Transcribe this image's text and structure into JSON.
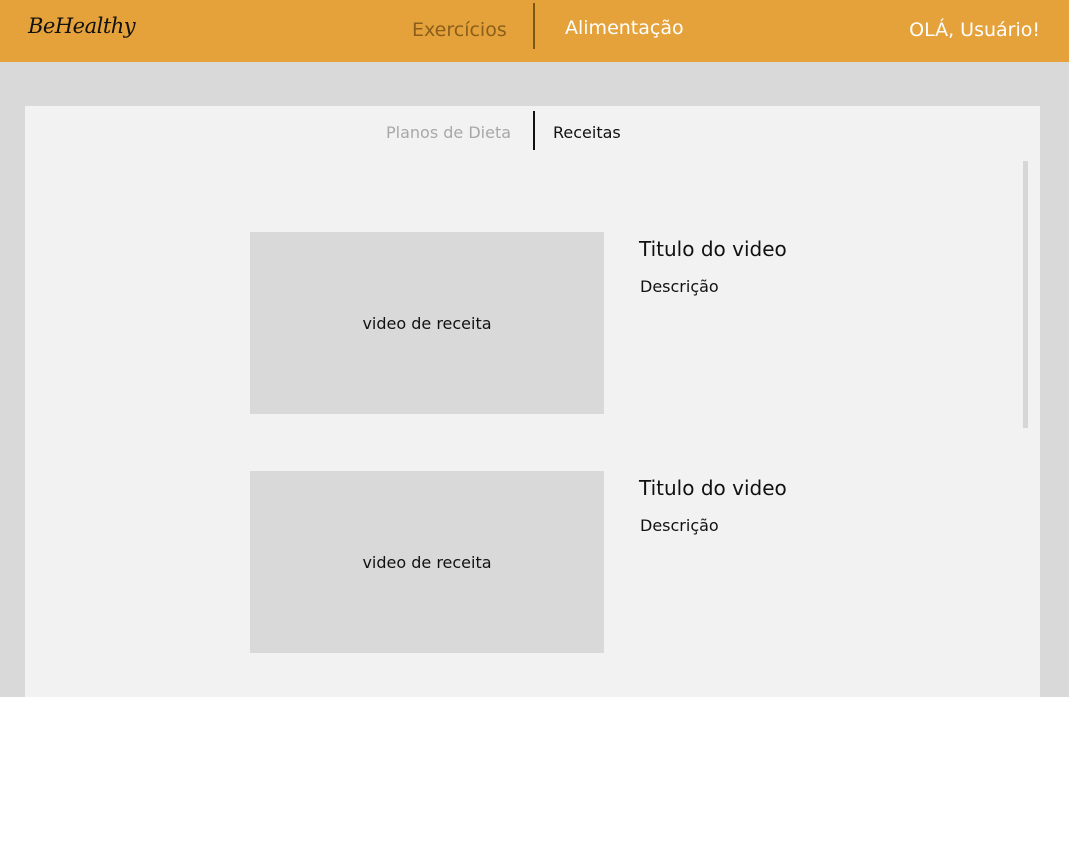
{
  "header": {
    "logo": "BeHealthy",
    "nav": {
      "exercicios": "Exercícios",
      "alimentacao": "Alimentação"
    },
    "greeting": "OLÁ, Usuário!"
  },
  "subtabs": {
    "planos": "Planos de Dieta",
    "receitas": "Receitas"
  },
  "videos": [
    {
      "thumb_label": "video de receita",
      "title": "Titulo do video",
      "description": "Descrição"
    },
    {
      "thumb_label": "video de receita",
      "title": "Titulo do video",
      "description": "Descrição"
    }
  ],
  "colors": {
    "header_bg": "#e5a23a",
    "backdrop": "#d9d9d9",
    "panel_bg": "#f2f2f2",
    "thumb_bg": "#d9d9d9"
  }
}
